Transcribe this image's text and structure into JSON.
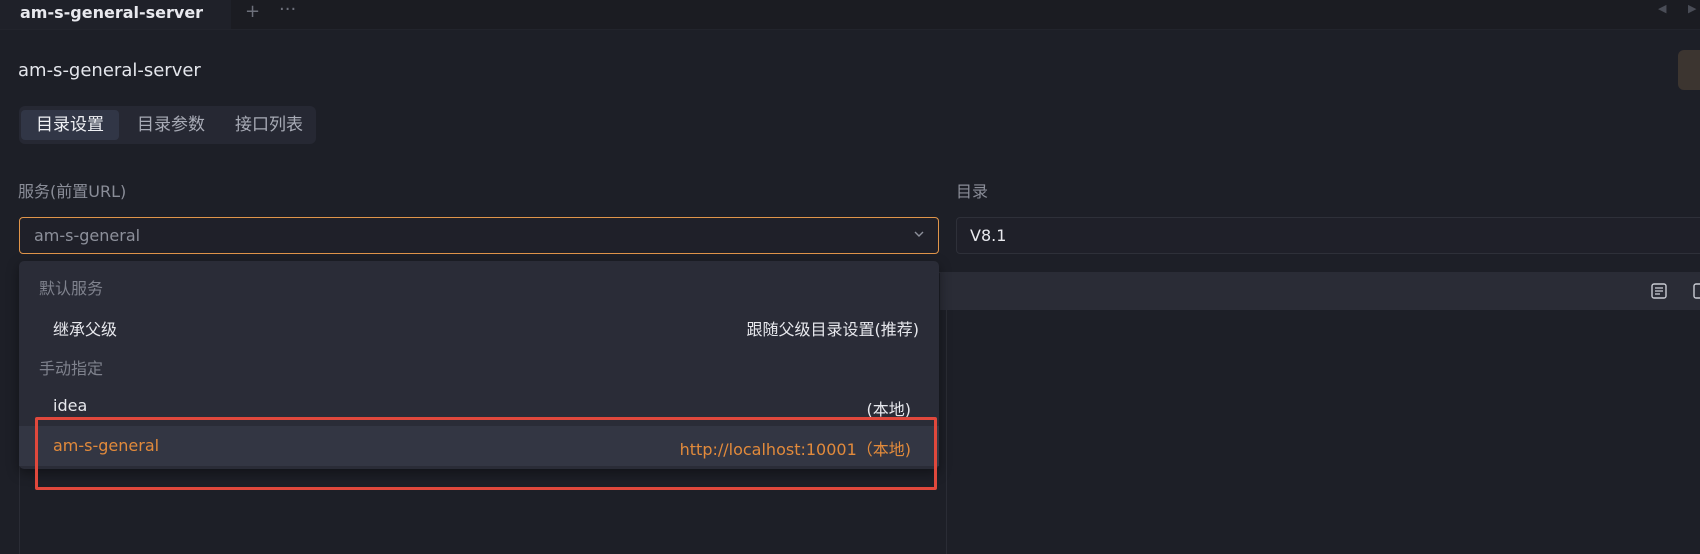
{
  "tabbar": {
    "active_tab": "am-s-general-server",
    "add_label": "+",
    "more_label": "···"
  },
  "page": {
    "title": "am-s-general-server"
  },
  "tabs": [
    {
      "label": "目录设置",
      "active": true
    },
    {
      "label": "目录参数",
      "active": false
    },
    {
      "label": "接口列表",
      "active": false
    }
  ],
  "service": {
    "label": "服务(前置URL)",
    "value": "am-s-general"
  },
  "directory": {
    "label": "目录",
    "value": "V8.1"
  },
  "dropdown": {
    "group_default": "默认服务",
    "group_manual": "手动指定",
    "options": [
      {
        "name": "继承父级",
        "desc": "跟随父级目录设置(推荐)"
      },
      {
        "name": "idea",
        "desc": "(本地)"
      },
      {
        "name": "am-s-general",
        "desc": "http://localhost:10001（本地)",
        "selected": true
      }
    ]
  },
  "colors": {
    "accent": "#e28a3b",
    "highlight_border": "#e0483c",
    "background": "#1d1f27"
  },
  "icons": [
    "chevron-down-icon",
    "document-icon",
    "expand-icon",
    "scroll-left-icon",
    "scroll-right-icon"
  ]
}
